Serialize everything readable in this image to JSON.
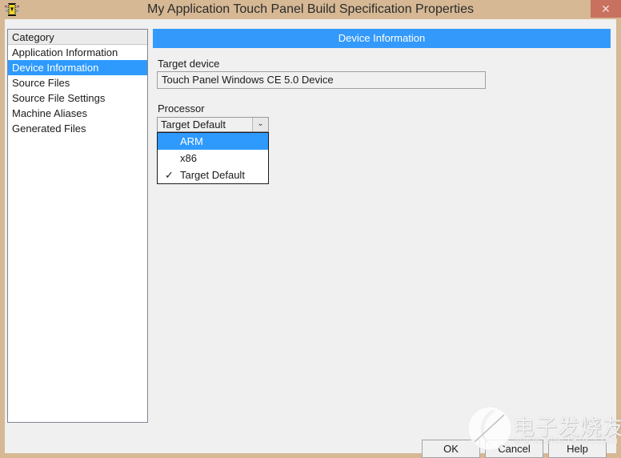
{
  "window": {
    "title": "My Application Touch Panel Build Specification Properties",
    "icon": "labview-build-spec-icon",
    "close_label": "✕",
    "frame_color": "#d6b894",
    "body_color": "#f0f0f0"
  },
  "category_list": {
    "header": "Category",
    "items": [
      {
        "label": "Application Information",
        "selected": false
      },
      {
        "label": "Device Information",
        "selected": true
      },
      {
        "label": "Source Files",
        "selected": false
      },
      {
        "label": "Source File Settings",
        "selected": false
      },
      {
        "label": "Machine Aliases",
        "selected": false
      },
      {
        "label": "Generated Files",
        "selected": false
      }
    ],
    "selection_color": "#2e9afe"
  },
  "content": {
    "panel_title": "Device Information",
    "panel_title_color": "#3399fb",
    "target_device": {
      "label": "Target device",
      "value": "Touch Panel Windows CE 5.0 Device"
    },
    "processor": {
      "label": "Processor",
      "selected_value": "Target Default",
      "arrow_icon": "chevron-down-icon",
      "arrow_glyph": "⌄",
      "dropdown_open": true,
      "options": [
        {
          "label": "ARM",
          "checked": false,
          "highlighted": true
        },
        {
          "label": "x86",
          "checked": false,
          "highlighted": false
        },
        {
          "label": "Target Default",
          "checked": true,
          "highlighted": false
        }
      ],
      "check_glyph": "✓"
    }
  },
  "buttons": {
    "ok": "OK",
    "cancel": "Cancel",
    "help": "Help"
  },
  "watermark": {
    "chinese": "电子发烧友",
    "url": "www.elecfans.com",
    "logo": "elecfans-swirl-logo"
  }
}
